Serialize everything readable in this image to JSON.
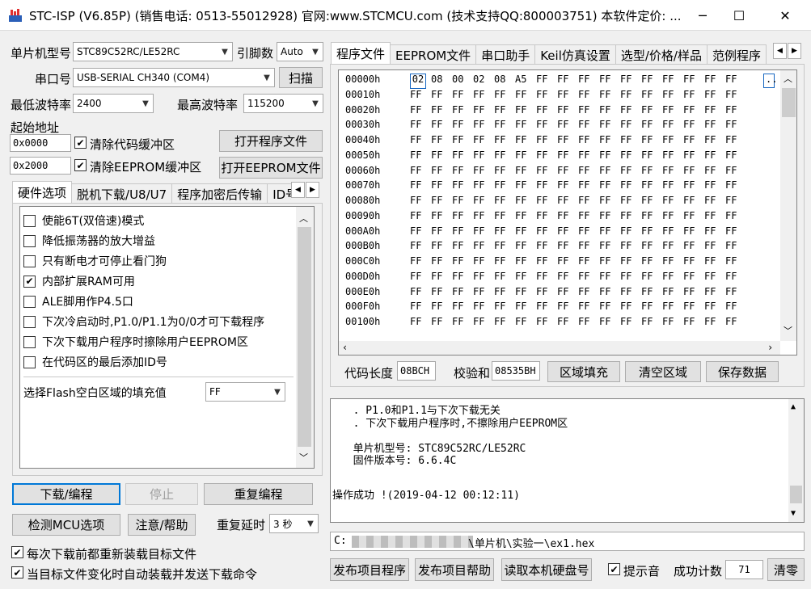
{
  "window": {
    "title": "STC-ISP (V6.85P) (销售电话: 0513-55012928) 官网:www.STCMCU.com  (技术支持QQ:800003751) 本软件定价: ...",
    "minimize": "─",
    "maximize": "☐",
    "close": "✕"
  },
  "mcu": {
    "chip_label": "单片机型号",
    "chip_value": "STC89C52RC/LE52RC",
    "pins_label": "引脚数",
    "pins_value": "Auto",
    "port_label": "串口号",
    "port_value": "USB-SERIAL CH340 (COM4)",
    "scan_button": "扫描",
    "min_baud_label": "最低波特率",
    "min_baud_value": "2400",
    "max_baud_label": "最高波特率",
    "max_baud_value": "115200"
  },
  "address": {
    "start_label": "起始地址",
    "code_addr": "0x0000",
    "clear_code": "清除代码缓冲区",
    "open_program": "打开程序文件",
    "eeprom_addr": "0x2000",
    "clear_eeprom": "清除EEPROM缓冲区",
    "open_eeprom": "打开EEPROM文件"
  },
  "left_tabs": [
    "硬件选项",
    "脱机下载/U8/U7",
    "程序加密后传输",
    "ID号"
  ],
  "options": [
    {
      "label": "使能6T(双倍速)模式",
      "checked": false
    },
    {
      "label": "降低振荡器的放大增益",
      "checked": false
    },
    {
      "label": "只有断电才可停止看门狗",
      "checked": false
    },
    {
      "label": "内部扩展RAM可用",
      "checked": true
    },
    {
      "label": "ALE脚用作P4.5口",
      "checked": false
    },
    {
      "label": "下次冷启动时,P1.0/P1.1为0/0才可下载程序",
      "checked": false
    },
    {
      "label": "下次下载用户程序时擦除用户EEPROM区",
      "checked": false
    },
    {
      "label": "在代码区的最后添加ID号",
      "checked": false
    }
  ],
  "fill": {
    "label": "选择Flash空白区域的填充值",
    "value": "FF"
  },
  "actions": {
    "download": "下载/编程",
    "stop": "停止",
    "reprogram": "重复编程",
    "detect": "检测MCU选项",
    "help": "注意/帮助",
    "delay_label": "重复延时",
    "delay_value": "3 秒",
    "reload_each": "每次下载前都重新装载目标文件",
    "auto_send": "当目标文件变化时自动装载并发送下载命令"
  },
  "right_tabs": [
    "程序文件",
    "EEPROM文件",
    "串口助手",
    "Keil仿真设置",
    "选型/价格/样品",
    "范例程序"
  ],
  "hex": {
    "addresses": [
      "00000h",
      "00010h",
      "00020h",
      "00030h",
      "00040h",
      "00050h",
      "00060h",
      "00070h",
      "00080h",
      "00090h",
      "000A0h",
      "000B0h",
      "000C0h",
      "000D0h",
      "000E0h",
      "000F0h",
      "00100h"
    ],
    "first_row": [
      "02",
      "08",
      "00",
      "02",
      "08",
      "A5",
      "FF",
      "FF",
      "FF",
      "FF",
      "FF",
      "FF",
      "FF",
      "FF",
      "FF",
      "FF"
    ],
    "fill_byte": "FF",
    "ascii_first": ".."
  },
  "info": {
    "code_len_label": "代码长度",
    "code_len": "08BCH",
    "checksum_label": "校验和",
    "checksum": "08535BH",
    "fill_region": "区域填充",
    "clear_region": "清空区域",
    "save_data": "保存数据"
  },
  "log": {
    "lines": [
      "  . P1.0和P1.1与下次下载无关",
      "  . 下次下载用户程序时,不擦除用户EEPROM区",
      "",
      "  单片机型号: STC89C52RC/LE52RC",
      "  固件版本号: 6.6.4C",
      "",
      "",
      "操作成功 !(2019-04-12 00:12:11)"
    ]
  },
  "bottom": {
    "path_prefix": "C:",
    "path_suffix": "\\单片机\\实验一\\ex1.hex",
    "publish_program": "发布项目程序",
    "publish_help": "发布项目帮助",
    "read_disk": "读取本机硬盘号",
    "beep": "提示音",
    "count_label": "成功计数",
    "count_value": "71",
    "clear": "清零"
  },
  "colors": {
    "accent": "#0078d7",
    "selection_border": "#1565c0"
  }
}
